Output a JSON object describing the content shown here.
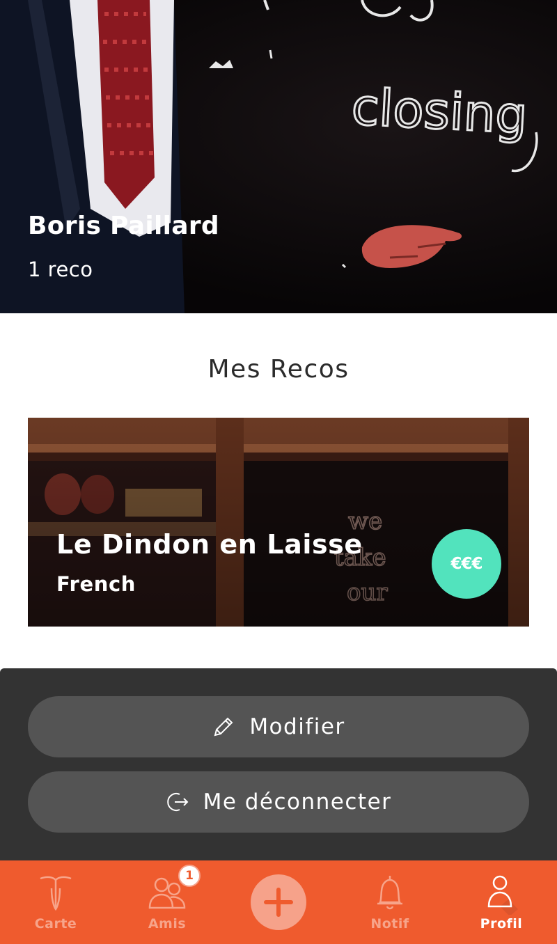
{
  "profile": {
    "name": "Boris Paillard",
    "reco_count": "1 reco"
  },
  "section": {
    "title": "Mes Recos"
  },
  "recos": [
    {
      "name": "Le Dindon en Laisse",
      "cuisine": "French",
      "price": "€€€"
    }
  ],
  "actions": {
    "edit_label": "Modifier",
    "edit_icon": "pencil-icon",
    "logout_label": "Me déconnecter",
    "logout_icon": "logout-icon"
  },
  "tabbar": {
    "carte_label": "Carte",
    "amis_label": "Amis",
    "amis_badge": "1",
    "add_icon": "plus-icon",
    "notif_label": "Notif",
    "profil_label": "Profil",
    "active": "Profil"
  },
  "colors": {
    "accent": "#ef5b2e",
    "price_badge": "#52e3bd",
    "panel": "#333333",
    "button": "#545454"
  }
}
